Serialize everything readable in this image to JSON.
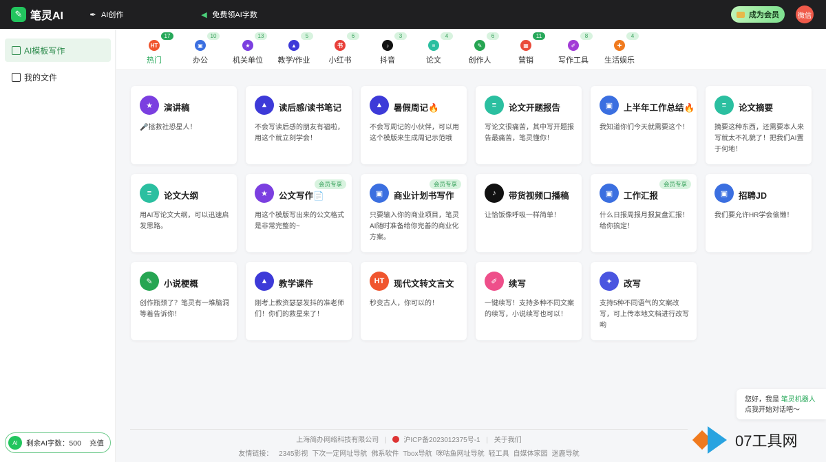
{
  "topbar": {
    "logo_mark": "✎",
    "logo_text": "笔灵AI",
    "ai_create": "AI创作",
    "free_words": "免费领AI字数",
    "vip_button": "成为会员",
    "avatar_text": "微信"
  },
  "sidebar": {
    "items": [
      {
        "label": "AI模板写作",
        "active": true
      },
      {
        "label": "我的文件",
        "active": false
      }
    ],
    "quota_badge": "AI",
    "quota_text": "剩余AI字数：500",
    "recharge": "充值"
  },
  "tabs": [
    {
      "label": "热门",
      "count": "17",
      "color": "#f0552e",
      "glyph": "HT",
      "active": true
    },
    {
      "label": "办公",
      "count": "10",
      "color": "#3b6fe0",
      "glyph": "▣"
    },
    {
      "label": "机关单位",
      "count": "13",
      "color": "#7b3fe0",
      "glyph": "★"
    },
    {
      "label": "教学/作业",
      "count": "5",
      "color": "#3d3ad8",
      "glyph": "▲"
    },
    {
      "label": "小红书",
      "count": "6",
      "color": "#e8403a",
      "glyph": "书"
    },
    {
      "label": "抖音",
      "count": "3",
      "color": "#111111",
      "glyph": "♪"
    },
    {
      "label": "论文",
      "count": "4",
      "color": "#2bbfa0",
      "glyph": "≡"
    },
    {
      "label": "创作人",
      "count": "6",
      "color": "#26a552",
      "glyph": "✎"
    },
    {
      "label": "营销",
      "count": "11",
      "color": "#ea4b3a",
      "glyph": "▦",
      "highlight": true
    },
    {
      "label": "写作工具",
      "count": "8",
      "color": "#a23bd6",
      "glyph": "✐"
    },
    {
      "label": "生活娱乐",
      "count": "4",
      "color": "#f07a1e",
      "glyph": "✚"
    }
  ],
  "cards": [
    {
      "title": "演讲稿",
      "desc": "🎤拯救社恐星人！",
      "color": "#7b3fe0",
      "glyph": "★",
      "vip": ""
    },
    {
      "title": "读后感/读书笔记",
      "desc": "不会写读后感的朋友有福啦，用这个就立刻学会！",
      "color": "#3d3ad8",
      "glyph": "▲",
      "vip": ""
    },
    {
      "title": "暑假周记🔥",
      "desc": "不会写周记的小伙伴，可以用这个模版来生成周记示范哦",
      "color": "#3d3ad8",
      "glyph": "▲",
      "vip": ""
    },
    {
      "title": "论文开题报告",
      "desc": "写论文很痛苦，其中写开题报告最痛苦，笔灵懂你！",
      "color": "#2bbfa0",
      "glyph": "≡",
      "vip": ""
    },
    {
      "title": "上半年工作总结🔥",
      "desc": "我知道你们今天就需要这个！",
      "color": "#3b6fe0",
      "glyph": "▣",
      "vip": ""
    },
    {
      "title": "论文摘要",
      "desc": "摘要这种东西，还需要本人来写就太不礼貌了！把我们AI置于何地！",
      "color": "#2bbfa0",
      "glyph": "≡",
      "vip": ""
    },
    {
      "title": "论文大纲",
      "desc": "用AI写论文大纲，可以迅速启发思路。",
      "color": "#2bbfa0",
      "glyph": "≡",
      "vip": ""
    },
    {
      "title": "公文写作📄",
      "desc": "用这个模版写出来的公文格式是非常完整的~",
      "color": "#7b3fe0",
      "glyph": "★",
      "vip": "会员专享"
    },
    {
      "title": "商业计划书写作",
      "desc": "只要输入你的商业项目，笔灵AI随时准备给你完善的商业化方案。",
      "color": "#3b6fe0",
      "glyph": "▣",
      "vip": "会员专享"
    },
    {
      "title": "带货视频口播稿",
      "desc": "让恰饭像呼吸一样简单！",
      "color": "#111111",
      "glyph": "♪",
      "vip": ""
    },
    {
      "title": "工作汇报",
      "desc": "什么日报周报月报复盘汇报！给你搞定！",
      "color": "#3b6fe0",
      "glyph": "▣",
      "vip": "会员专享"
    },
    {
      "title": "招聘JD",
      "desc": "我们要允许HR学会偷懒！",
      "color": "#3b6fe0",
      "glyph": "▣",
      "vip": ""
    },
    {
      "title": "小说梗概",
      "desc": "创作瓶颈了？笔灵有一堆脑洞等着告诉你！",
      "color": "#26a552",
      "glyph": "✎",
      "vip": ""
    },
    {
      "title": "教学课件",
      "desc": "刚考上教资瑟瑟发抖的准老师们！你们的救星来了！",
      "color": "#3d3ad8",
      "glyph": "▲",
      "vip": ""
    },
    {
      "title": "现代文转文言文",
      "desc": "秒变古人，你可以的！",
      "color": "#f0552e",
      "glyph": "HT",
      "vip": ""
    },
    {
      "title": "续写",
      "desc": "一键续写！支持多种不同文案的续写，小说续写也可以！",
      "color": "#ee4f8a",
      "glyph": "✐",
      "vip": ""
    },
    {
      "title": "改写",
      "desc": "支持5种不同语气的文案改写，可上传本地文档进行改写哟",
      "color": "#4a55e0",
      "glyph": "✦",
      "vip": ""
    }
  ],
  "footer": {
    "company": "上海简办网络科技有限公司",
    "icp": "沪ICP备2023012375号-1",
    "about": "关于我们",
    "links_label": "友情链接：",
    "links": [
      "2345影视",
      "下次一定网址导航",
      "佛系软件",
      "Tbox导航",
      "咪咕鱼网址导航",
      "轻工具",
      "自媒体家园",
      "迷鹿导航"
    ]
  },
  "chat": {
    "greeting": "您好，我是",
    "robot": "笔灵机器人",
    "prompt": "点我开始对话吧～"
  },
  "watermark": {
    "text": "07工具网"
  }
}
